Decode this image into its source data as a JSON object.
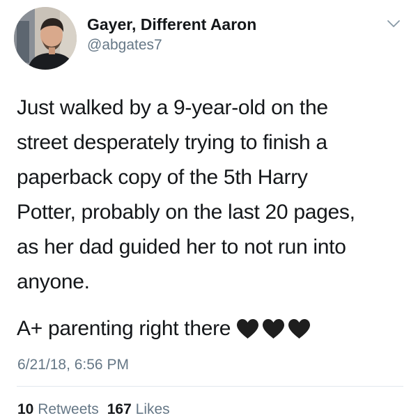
{
  "author": {
    "display_name": "Gayer, Different Aaron",
    "handle": "@abgates7",
    "avatar_icon": "profile-photo"
  },
  "menu_icon": "chevron-down-icon",
  "tweet": {
    "lines": [
      "Just walked by a 9-year-old on the",
      "street desperately trying to finish a",
      "paperback copy of the 5th Harry",
      "Potter, probably on the last 20 pages,",
      "as her dad guided her to not run into",
      "anyone."
    ],
    "closing_text": "A+ parenting right there",
    "emoji": [
      "black-heart",
      "black-heart",
      "black-heart"
    ]
  },
  "timestamp": "6/21/18, 6:56 PM",
  "stats": {
    "retweets_count": "10",
    "retweets_label": "Retweets",
    "likes_count": "167",
    "likes_label": "Likes"
  },
  "colors": {
    "text": "#14171a",
    "secondary": "#657786",
    "divider": "#e1e8ed"
  }
}
